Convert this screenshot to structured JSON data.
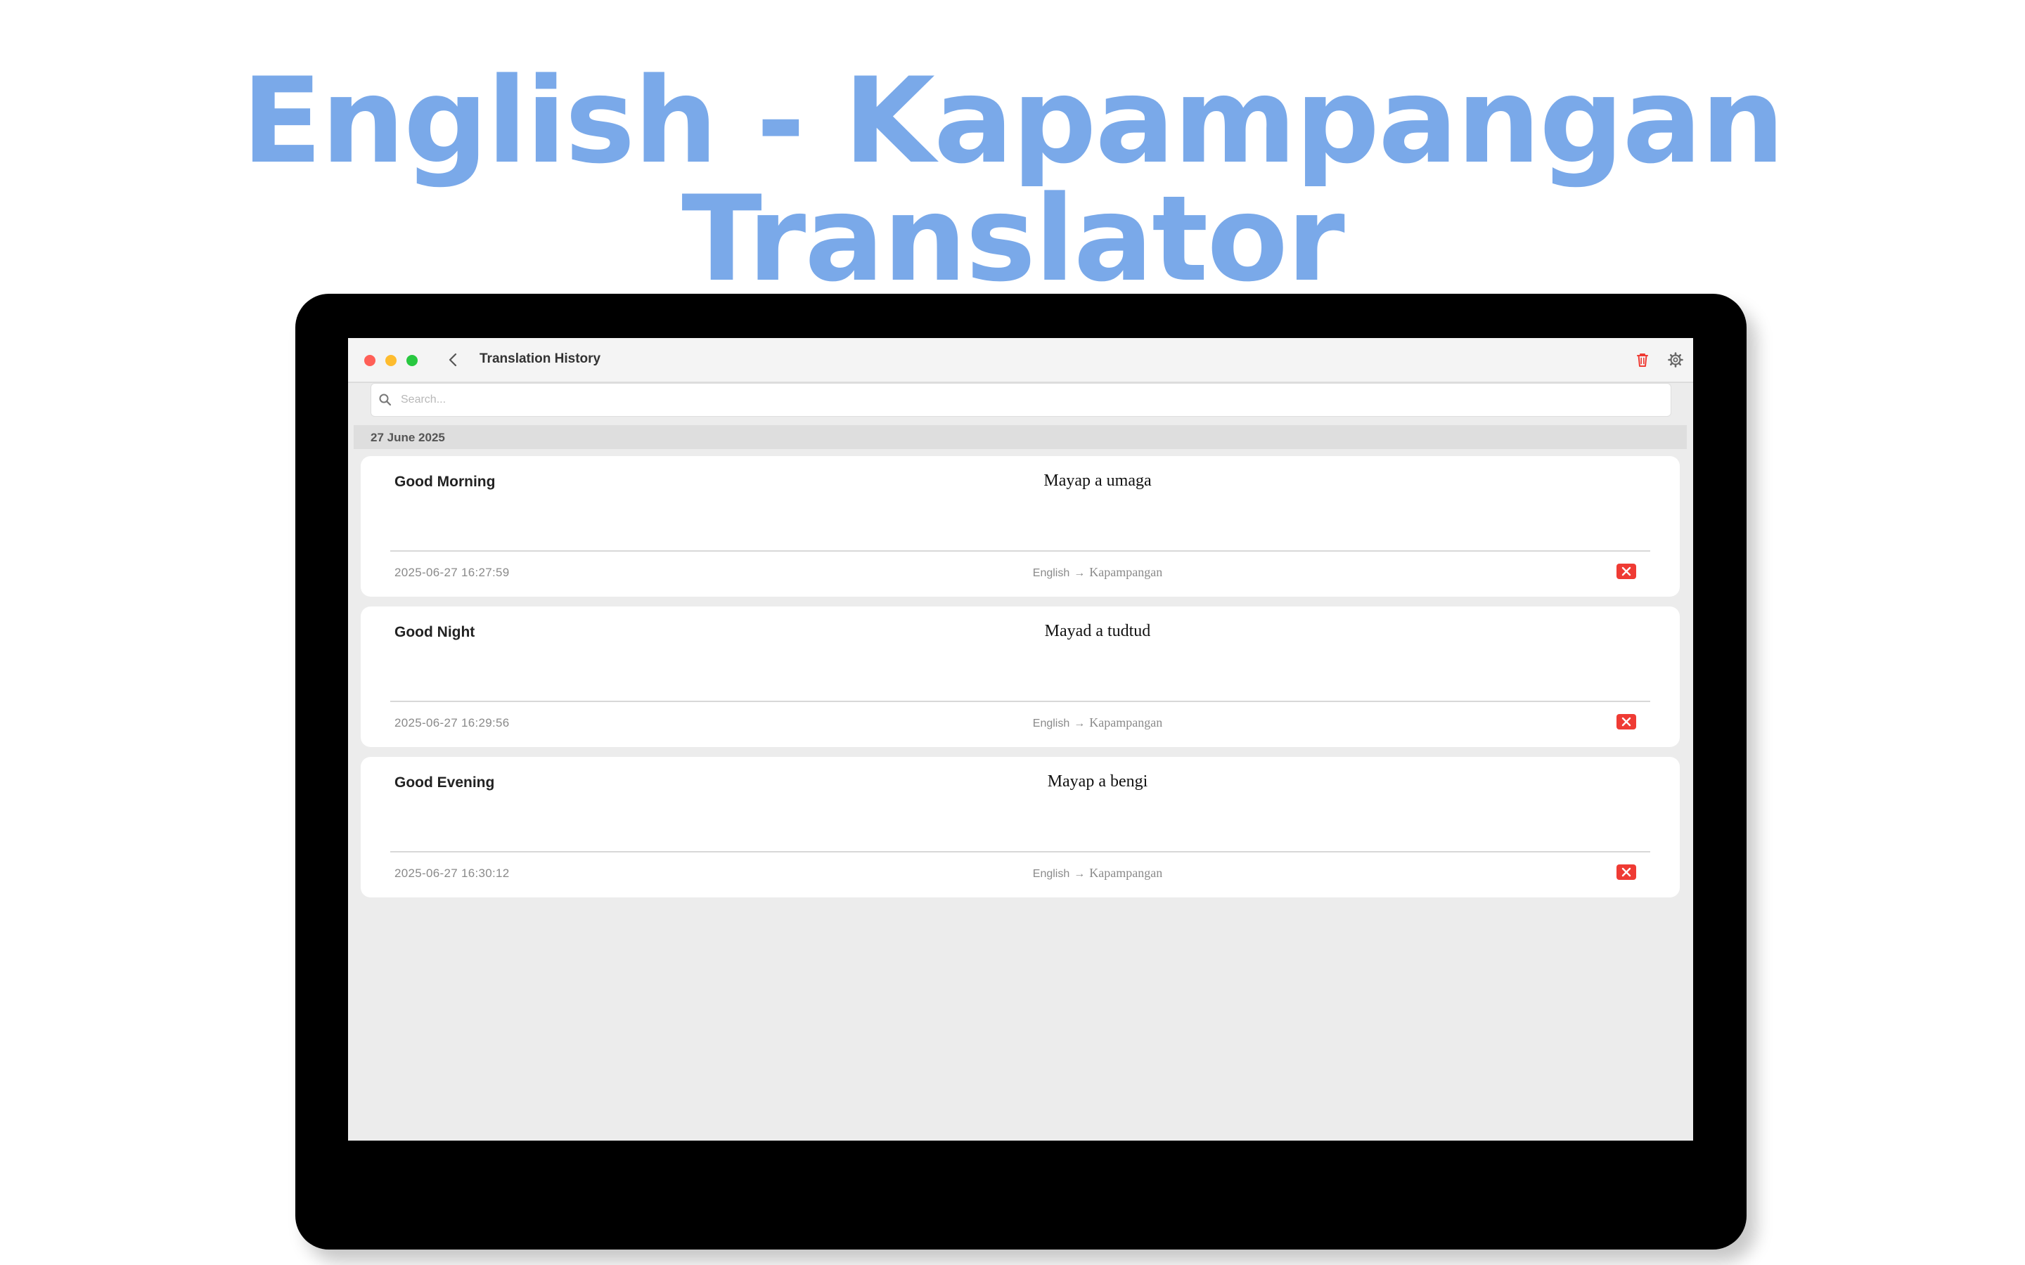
{
  "hero": {
    "title": "English - Kapampangan Translator"
  },
  "window": {
    "title": "Translation History",
    "search": {
      "placeholder": "Search...",
      "value": ""
    }
  },
  "history": {
    "date_header": "27 June 2025",
    "entries": [
      {
        "source": "Good Morning",
        "target": "Mayap a umaga",
        "timestamp": "2025-06-27 16:27:59",
        "from": "English",
        "arrow": "→",
        "to": "Kapampangan"
      },
      {
        "source": "Good Night",
        "target": "Mayad a tudtud",
        "timestamp": "2025-06-27 16:29:56",
        "from": "English",
        "arrow": "→",
        "to": "Kapampangan"
      },
      {
        "source": "Good Evening",
        "target": "Mayap a bengi",
        "timestamp": "2025-06-27 16:30:12",
        "from": "English",
        "arrow": "→",
        "to": "Kapampangan"
      }
    ]
  },
  "icons": {
    "back": "chevron-left-icon",
    "trash": "trash-icon",
    "settings": "gear-icon",
    "search": "search-icon",
    "delete": "close-icon"
  },
  "colors": {
    "hero_title": "#7aa9e9",
    "trash_icon": "#ef3b34",
    "delete_button": "#ef3b34"
  }
}
